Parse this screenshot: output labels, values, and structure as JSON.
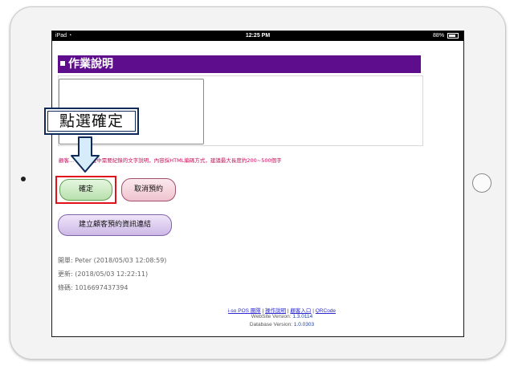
{
  "status_bar": {
    "device": "iPad",
    "time": "12:25 PM",
    "battery": "88%"
  },
  "section": {
    "title": "作業說明"
  },
  "note": "顧客... 作業流程中需要紀錄的文字說明，內容採HTML編碼方式，建議最大長度約200~500個字",
  "buttons": {
    "confirm": "確定",
    "cancel_booking": "取消預約",
    "create_link": "建立顧客預約資訊連結"
  },
  "meta": {
    "opened": "開單: Peter (2018/05/03 12:08:59)",
    "updated": "更新: (2018/05/03 12:22:11)",
    "barcode": "條碼: 1016697437394"
  },
  "footer": {
    "links": [
      "i-so POS 團隊",
      "操作說明",
      "顧客入口",
      "QRCode"
    ],
    "separator": "|",
    "website_label": "WebSite Version:",
    "website_version": "1.3.0114",
    "database_label": "Database Version:",
    "database_version": "1.0.0303"
  },
  "annotation": {
    "callout": "點選確定"
  },
  "colors": {
    "header_bg": "#5e0e8c",
    "note_text": "#c8105c",
    "highlight": "#e0121b",
    "callout_border": "#0d2a5a",
    "arrow_fill": "#d7ecfa"
  }
}
